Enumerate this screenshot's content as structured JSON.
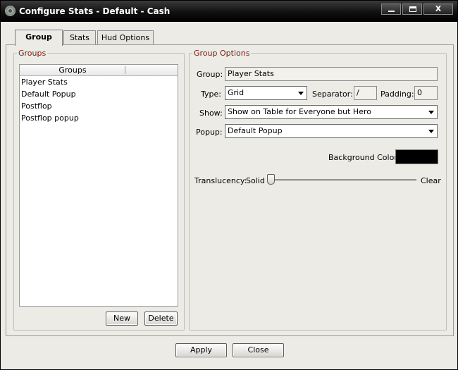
{
  "window": {
    "title": "Configure Stats - Default - Cash",
    "minimize_glyph": "",
    "close_glyph": "X"
  },
  "tabs": [
    {
      "label": "Group",
      "active": true
    },
    {
      "label": "Stats",
      "active": false
    },
    {
      "label": "Hud Options",
      "active": false
    }
  ],
  "groups_panel": {
    "legend": "Groups",
    "column_header": "Groups",
    "items": [
      "Player Stats",
      "Default Popup",
      "Postflop",
      "Postflop popup"
    ],
    "new_label": "New",
    "delete_label": "Delete"
  },
  "group_options": {
    "legend": "Group Options",
    "group_label": "Group:",
    "group_value": "Player Stats",
    "type_label": "Type:",
    "type_value": "Grid",
    "separator_label": "Separator:",
    "separator_value": "/",
    "padding_label": "Padding:",
    "padding_value": "0",
    "show_label": "Show:",
    "show_value": "Show on Table for Everyone but Hero",
    "popup_label": "Popup:",
    "popup_value": "Default Popup",
    "background_color_label": "Background Color:",
    "background_color": "#000000",
    "translucency_label": "Translucency:",
    "translucency_min_label": "Solid",
    "translucency_max_label": "Clear",
    "translucency_value": 0
  },
  "footer": {
    "apply_label": "Apply",
    "close_label": "Close"
  }
}
